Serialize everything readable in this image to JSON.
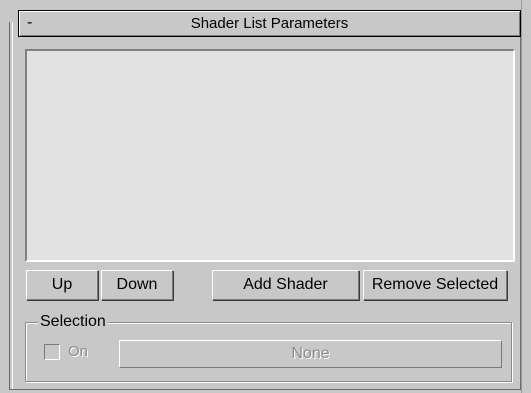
{
  "rollout": {
    "collapse_symbol": "-",
    "title": "Shader List Parameters"
  },
  "shader_list": {
    "items": []
  },
  "buttons": {
    "up": "Up",
    "down": "Down",
    "add_shader": "Add Shader",
    "remove_selected": "Remove Selected"
  },
  "selection": {
    "group_label": "Selection",
    "on_label": "On",
    "on_checked": false,
    "on_enabled": false,
    "value_button": "None"
  }
}
